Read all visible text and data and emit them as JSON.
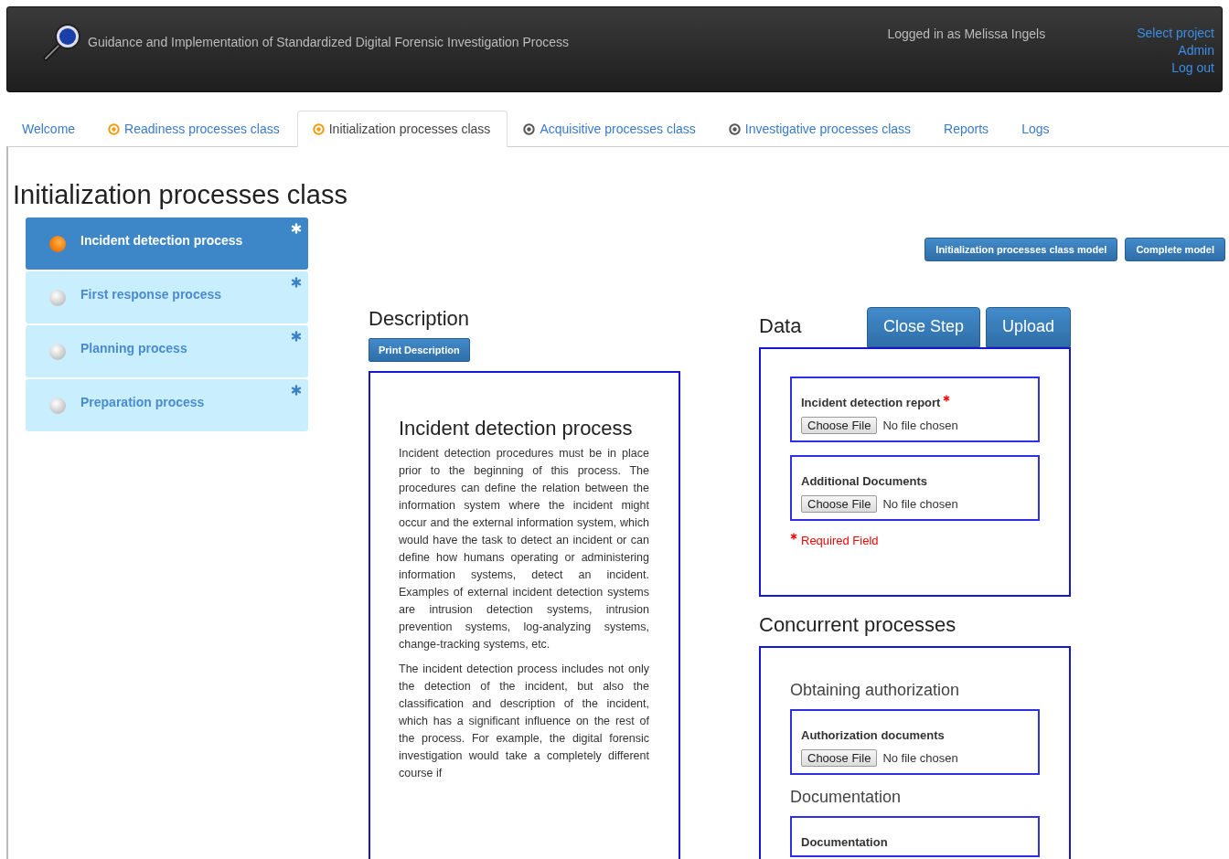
{
  "header": {
    "title": "Guidance and Implementation of Standardized Digital Forensic Investigation Process",
    "user": "Logged in as Melissa Ingels",
    "links": [
      "Select project",
      "Admin",
      "Log out"
    ]
  },
  "tabs": [
    {
      "label": "Welcome",
      "selected": false
    },
    {
      "label": "Readiness processes class",
      "selected": false,
      "color": "#f39c12"
    },
    {
      "label": "Initialization processes class",
      "selected": true,
      "color": "#f39c12"
    },
    {
      "label": "Acquisitive processes class",
      "selected": false,
      "color": "#555555"
    },
    {
      "label": "Investigative processes class",
      "selected": false,
      "color": "#555555"
    },
    {
      "label": "Reports",
      "selected": false
    },
    {
      "label": "Logs",
      "selected": false
    }
  ],
  "page_title": "Initialization processes class",
  "processes": [
    {
      "label": "Incident detection process",
      "selected": true
    },
    {
      "label": "First response process",
      "selected": false
    },
    {
      "label": "Planning process",
      "selected": false
    },
    {
      "label": "Preparation process",
      "selected": false
    }
  ],
  "model_buttons": [
    "Initialization processes class model",
    "Complete model"
  ],
  "description": {
    "heading": "Description",
    "print_button": "Print Description",
    "title": "Incident detection process",
    "paragraphs": [
      "Incident detection procedures must be in place prior to the beginning of this process. The procedures can define the relation between the information system where the incident might occur and the external information system, which would have the task to detect an incident or can define how humans operating or administering information systems, detect an incident. Examples of external incident detection systems are intrusion detection systems, intrusion prevention systems, log-analyzing systems, change-tracking systems, etc.",
      "The incident detection process includes not only the detection of the incident, but also the classification and description of the incident, which has a significant influence on the rest of the process. For example, the digital forensic investigation would take a completely different course if"
    ]
  },
  "data": {
    "heading": "Data",
    "buttons": [
      "Close Step",
      "Upload"
    ],
    "fields": [
      {
        "label": "Incident detection report",
        "required": true,
        "file_button": "Choose File",
        "file_status": "No file chosen"
      },
      {
        "label": "Additional Documents",
        "required": false,
        "file_button": "Choose File",
        "file_status": "No file chosen"
      }
    ],
    "legend": "Required Field"
  },
  "concurrent": {
    "heading": "Concurrent processes",
    "groups": [
      {
        "title": "Obtaining authorization",
        "fields": [
          {
            "label": "Authorization documents",
            "required": false,
            "file_button": "Choose File",
            "file_status": "No file chosen"
          }
        ]
      },
      {
        "title": "Documentation",
        "fields": [
          {
            "label": "Documentation",
            "required": false
          }
        ]
      }
    ]
  }
}
